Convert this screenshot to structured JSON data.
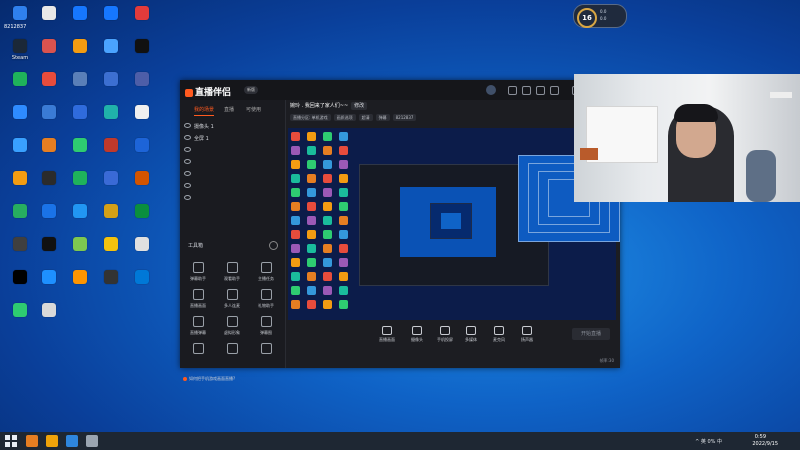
{
  "desktop": {
    "top_label": "8212837",
    "icons": [
      {
        "label": "",
        "color": "#2f80ed"
      },
      {
        "label": "",
        "color": "#e8e8e8"
      },
      {
        "label": "",
        "color": "#1677ff"
      },
      {
        "label": "",
        "color": "#1677ff"
      },
      {
        "label": "",
        "color": "#e23b3b"
      },
      {
        "label": "Steam",
        "color": "#1b2838"
      },
      {
        "label": "",
        "color": "#d9534f"
      },
      {
        "label": "",
        "color": "#f39c12"
      },
      {
        "label": "",
        "color": "#4aa3ff"
      },
      {
        "label": "",
        "color": "#111111"
      },
      {
        "label": "",
        "color": "#1fb35b"
      },
      {
        "label": "",
        "color": "#e74c3c"
      },
      {
        "label": "",
        "color": "#5a7fb8"
      },
      {
        "label": "",
        "color": "#3c6fd1"
      },
      {
        "label": "",
        "color": "#4d5ea8"
      },
      {
        "label": "",
        "color": "#2e8bff"
      },
      {
        "label": "",
        "color": "#3a7bd5"
      },
      {
        "label": "",
        "color": "#2f6bdc"
      },
      {
        "label": "",
        "color": "#20b2aa"
      },
      {
        "label": "",
        "color": "#f0f0f0"
      },
      {
        "label": "",
        "color": "#39a0ff"
      },
      {
        "label": "",
        "color": "#e67e22"
      },
      {
        "label": "",
        "color": "#2ecc71"
      },
      {
        "label": "",
        "color": "#c0392b"
      },
      {
        "label": "",
        "color": "#1d64d8"
      },
      {
        "label": "",
        "color": "#f39c12"
      },
      {
        "label": "",
        "color": "#2b2b2b"
      },
      {
        "label": "",
        "color": "#1fb35b"
      },
      {
        "label": "",
        "color": "#3a6ad6"
      },
      {
        "label": "",
        "color": "#d35400"
      },
      {
        "label": "",
        "color": "#27ae60"
      },
      {
        "label": "",
        "color": "#1a73e8"
      },
      {
        "label": "",
        "color": "#2196f3"
      },
      {
        "label": "",
        "color": "#d4a017"
      },
      {
        "label": "",
        "color": "#0a8f3e"
      },
      {
        "label": "",
        "color": "#3f3f3f"
      },
      {
        "label": "",
        "color": "#111111"
      },
      {
        "label": "",
        "color": "#7ec850"
      },
      {
        "label": "",
        "color": "#f4c20d"
      },
      {
        "label": "",
        "color": "#e0e0e0"
      },
      {
        "label": "",
        "color": "#000000"
      },
      {
        "label": "",
        "color": "#1e90ff"
      },
      {
        "label": "",
        "color": "#ff9500"
      },
      {
        "label": "",
        "color": "#333333"
      },
      {
        "label": "",
        "color": "#0078d7"
      },
      {
        "label": "",
        "color": "#2ecc71"
      },
      {
        "label": "",
        "color": "#d9d9d9"
      }
    ]
  },
  "badge": {
    "number": "16",
    "line1": "0.0",
    "line2": "0.0"
  },
  "app": {
    "logo": "直播伴侣",
    "version": "新版",
    "tabs": [
      "我的场景",
      "直播",
      "可使用"
    ],
    "sources": [
      {
        "name": "摄像头 1",
        "dim": false
      },
      {
        "name": "全屏 1",
        "dim": false
      },
      {
        "name": "",
        "dim": true
      },
      {
        "name": "",
        "dim": true
      },
      {
        "name": "",
        "dim": true
      },
      {
        "name": "",
        "dim": true
      },
      {
        "name": "",
        "dim": true
      }
    ],
    "tools_title": "工具箱",
    "tools": [
      {
        "label": "弹幕助手"
      },
      {
        "label": "观看助手"
      },
      {
        "label": "主播任务"
      },
      {
        "label": "直播画面"
      },
      {
        "label": "多人连麦"
      },
      {
        "label": "礼物助手"
      },
      {
        "label": "直播弹幕"
      },
      {
        "label": "虚拟形象"
      },
      {
        "label": "弹幕图"
      },
      {
        "label": ""
      },
      {
        "label": ""
      },
      {
        "label": ""
      }
    ],
    "tip": "如何把手机游戏画面直播?",
    "header": {
      "title": "婉玲 . 我回来了家人们~~",
      "edit": "修改"
    },
    "header2": [
      "直播分区: 单机游戏",
      "画质选项",
      "超清",
      "弹幕",
      "8212837"
    ],
    "actions": [
      {
        "label": "直播画面"
      },
      {
        "label": "摄像头"
      },
      {
        "label": "手机投屏"
      },
      {
        "label": "多媒体"
      },
      {
        "label": "麦克风"
      },
      {
        "label": "扬声器"
      }
    ],
    "start_button": "开始直播",
    "fps": "帧率:30"
  },
  "taskbar": {
    "apps": [
      "#e67e22",
      "#f0a30a",
      "#2e86de",
      "#9aa5b1"
    ],
    "tray": "^ 英 0% 中",
    "time": "0:59",
    "date": "2022/9/15"
  },
  "colors": {
    "accent": "#ff5a1f",
    "desktop": "#0f63c7"
  }
}
